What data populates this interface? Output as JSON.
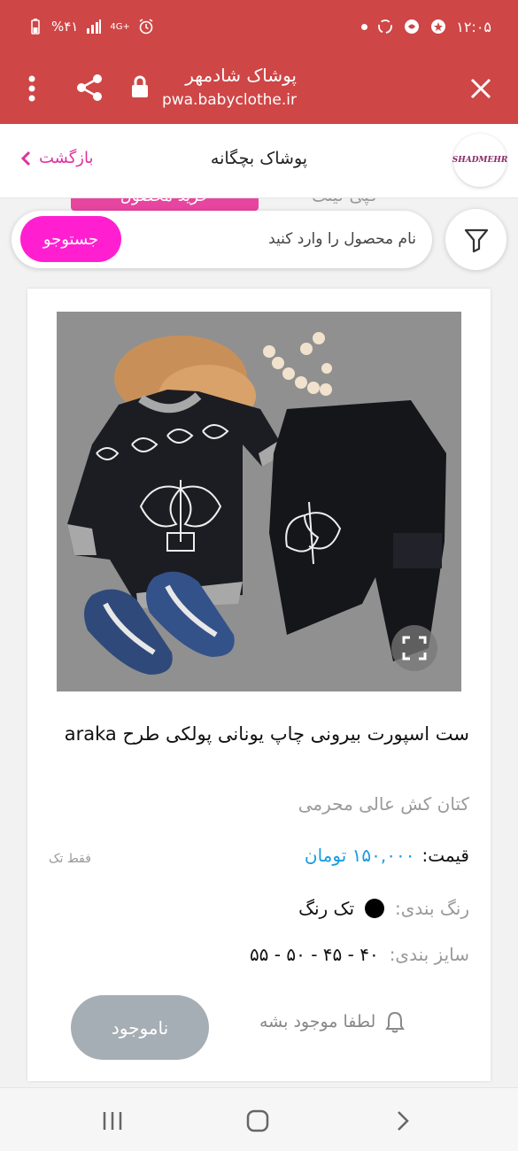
{
  "status_bar": {
    "time": "۱۲:۰۵",
    "battery": "%۴۱",
    "network": "4G+"
  },
  "tab_bar": {
    "site_title": "پوشاک شادمهر",
    "url": "pwa.babyclothe.ir"
  },
  "header": {
    "logo_text": "SHADMEHR",
    "page_title": "پوشاک بچگانه",
    "back_label": "بازگشت"
  },
  "ghost_row": {
    "button_label": "خرید محصول",
    "text": "کپی لینک"
  },
  "search": {
    "placeholder": "نام محصول را وارد کنید",
    "button_label": "جستوجو"
  },
  "product": {
    "name": "ست اسپورت بیرونی چاپ یونانی پولکی طرح araka",
    "subtitle": "کتان کش عالی محرمی",
    "price_label": "قیمت:",
    "price_value": "۱۵۰,۰۰۰ تومان",
    "only_single": "فقط تک",
    "color_label": "رنگ بندی:",
    "color_value": "تک رنگ",
    "size_label": "سایز بندی:",
    "size_value": "۴۰ - ۴۵ - ۵۰ - ۵۵",
    "notify_label": "لطفا موجود بشه",
    "out_of_stock_label": "ناموجود"
  },
  "colors": {
    "brand_red": "#cf4646",
    "accent_pink": "#ff1fd0",
    "price_blue": "#1a9be0",
    "disabled_gray": "#a6aeb5"
  }
}
